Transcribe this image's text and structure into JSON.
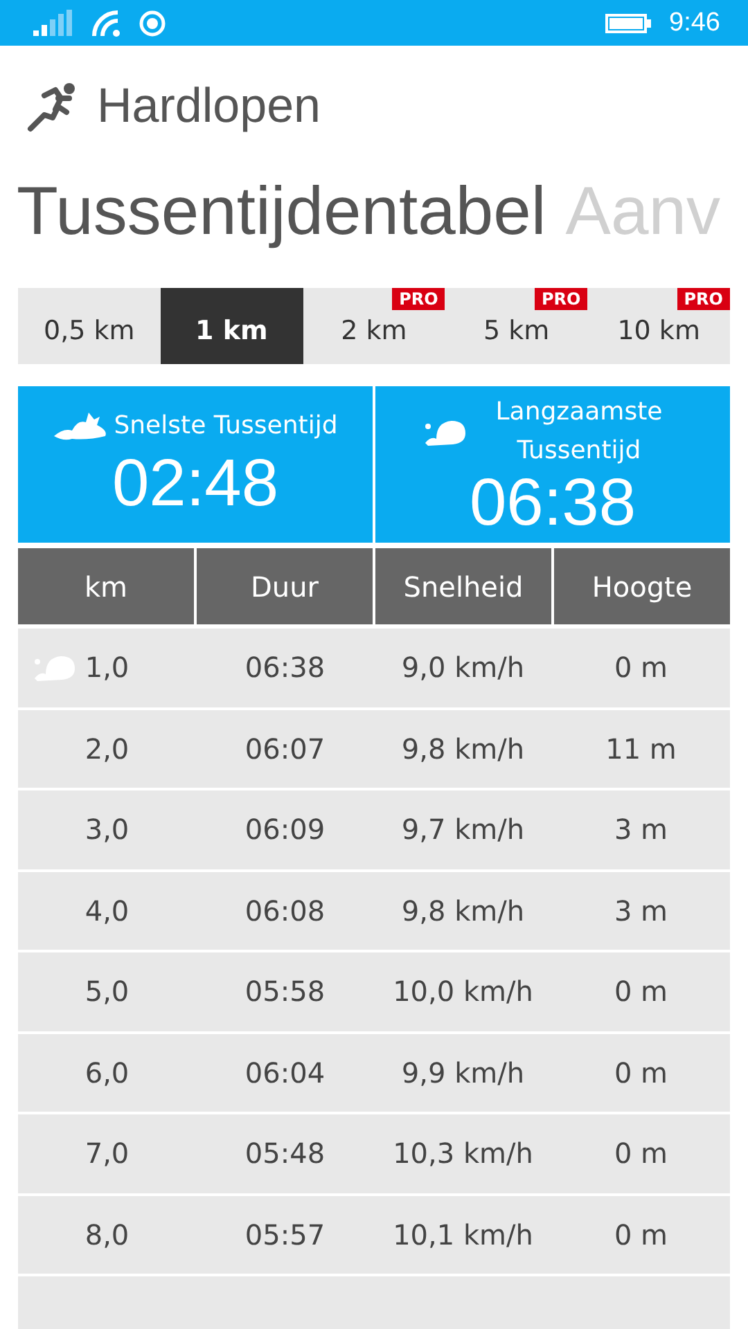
{
  "status_bar": {
    "time": "9:46"
  },
  "app_title": "Hardlopen",
  "pivot": [
    {
      "label": "Tussentijdentabel",
      "selected": true
    },
    {
      "label": "Aanv",
      "selected": false
    }
  ],
  "tabs": [
    {
      "label": "0,5 km",
      "selected": false
    },
    {
      "label": "1 km",
      "selected": true
    },
    {
      "label": "2 km",
      "selected": false,
      "badge": "PRO"
    },
    {
      "label": "5 km",
      "selected": false,
      "badge": "PRO"
    },
    {
      "label": "10 km",
      "selected": false,
      "badge": "PRO"
    }
  ],
  "summary": [
    {
      "kind": "fastest",
      "label": "Snelste Tussentijd",
      "value": "02:48"
    },
    {
      "kind": "slowest",
      "label": "Langzaamste Tussentijd",
      "value": "06:38"
    }
  ],
  "table": {
    "columns": [
      "km",
      "Duur",
      "Snelheid",
      "Hoogte"
    ],
    "rows": [
      {
        "kind": "slowest",
        "cells": [
          "1,0",
          "06:38",
          "9,0 km/h",
          "0 m"
        ]
      },
      {
        "kind": "plain",
        "cells": [
          "2,0",
          "06:07",
          "9,8 km/h",
          "11 m"
        ]
      },
      {
        "kind": "plain",
        "cells": [
          "3,0",
          "06:09",
          "9,7 km/h",
          "3 m"
        ]
      },
      {
        "kind": "plain",
        "cells": [
          "4,0",
          "06:08",
          "9,8 km/h",
          "3 m"
        ]
      },
      {
        "kind": "plain",
        "cells": [
          "5,0",
          "05:58",
          "10,0 km/h",
          "0 m"
        ]
      },
      {
        "kind": "plain",
        "cells": [
          "6,0",
          "06:04",
          "9,9 km/h",
          "0 m"
        ]
      },
      {
        "kind": "plain",
        "cells": [
          "7,0",
          "05:48",
          "10,3 km/h",
          "0 m"
        ]
      },
      {
        "kind": "plain",
        "cells": [
          "8,0",
          "05:57",
          "10,1 km/h",
          "0 m"
        ]
      },
      {
        "kind": "plain",
        "cells": []
      }
    ]
  }
}
